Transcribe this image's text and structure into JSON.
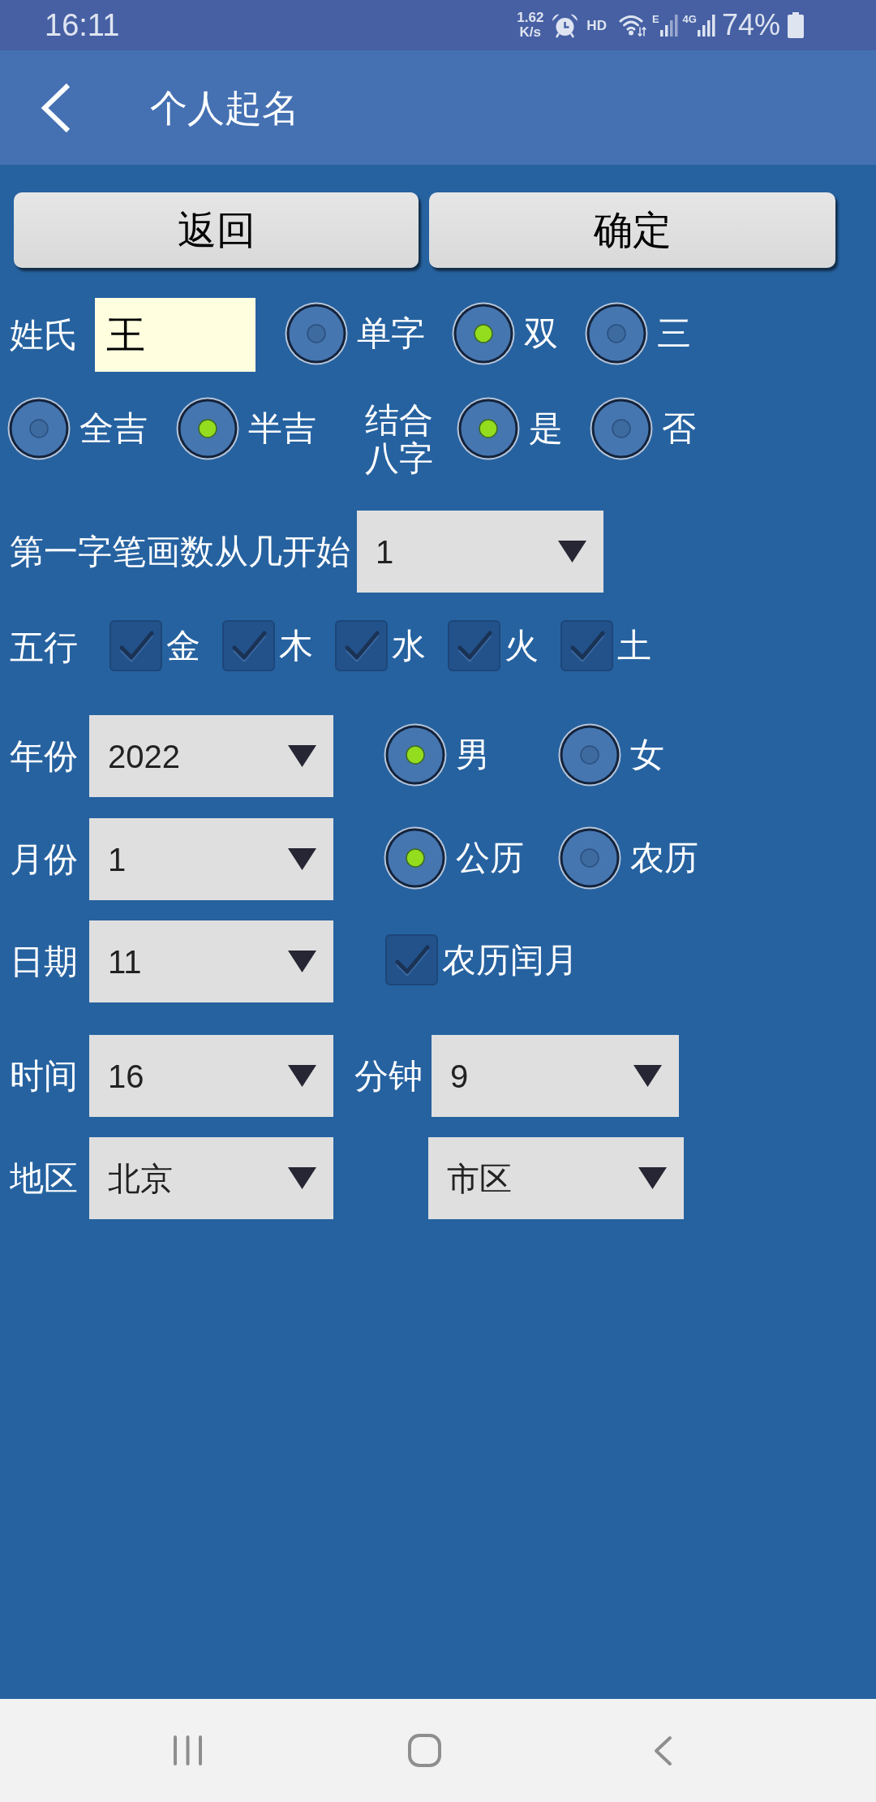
{
  "status_bar": {
    "time": "16:11",
    "speed": "1.62",
    "speed_unit": "K/s",
    "hd": "HD",
    "mobile_type": "E",
    "network": "4G",
    "battery": "74%"
  },
  "app_bar": {
    "title": "个人起名"
  },
  "actions": [
    {
      "label": "返回"
    },
    {
      "label": "确定"
    }
  ],
  "surname": {
    "label": "姓氏",
    "value": "王"
  },
  "name_length": [
    {
      "label": "单字",
      "selected": false
    },
    {
      "label": "双",
      "selected": true
    },
    {
      "label": "三",
      "selected": false
    }
  ],
  "luck": [
    {
      "label": "全吉",
      "selected": false
    },
    {
      "label": "半吉",
      "selected": true
    }
  ],
  "bazi": {
    "label": "结合八字",
    "options": [
      {
        "label": "是",
        "selected": true
      },
      {
        "label": "否",
        "selected": false
      }
    ]
  },
  "first_stroke": {
    "label": "第一字笔画数从几开始",
    "value": "1"
  },
  "five_elements": {
    "label": "五行",
    "items": [
      {
        "label": "金",
        "checked": true
      },
      {
        "label": "木",
        "checked": true
      },
      {
        "label": "水",
        "checked": true
      },
      {
        "label": "火",
        "checked": true
      },
      {
        "label": "土",
        "checked": true
      }
    ]
  },
  "year": {
    "label": "年份",
    "value": "2022"
  },
  "gender": [
    {
      "label": "男",
      "selected": true
    },
    {
      "label": "女",
      "selected": false
    }
  ],
  "month": {
    "label": "月份",
    "value": "1"
  },
  "calendar": [
    {
      "label": "公历",
      "selected": true
    },
    {
      "label": "农历",
      "selected": false
    }
  ],
  "day": {
    "label": "日期",
    "value": "11"
  },
  "leap_month": {
    "label": "农历闰月",
    "checked": true
  },
  "hour": {
    "label": "时间",
    "value": "16"
  },
  "minute": {
    "label": "分钟",
    "value": "9"
  },
  "region": {
    "label": "地区",
    "province": "北京",
    "district": "市区"
  }
}
